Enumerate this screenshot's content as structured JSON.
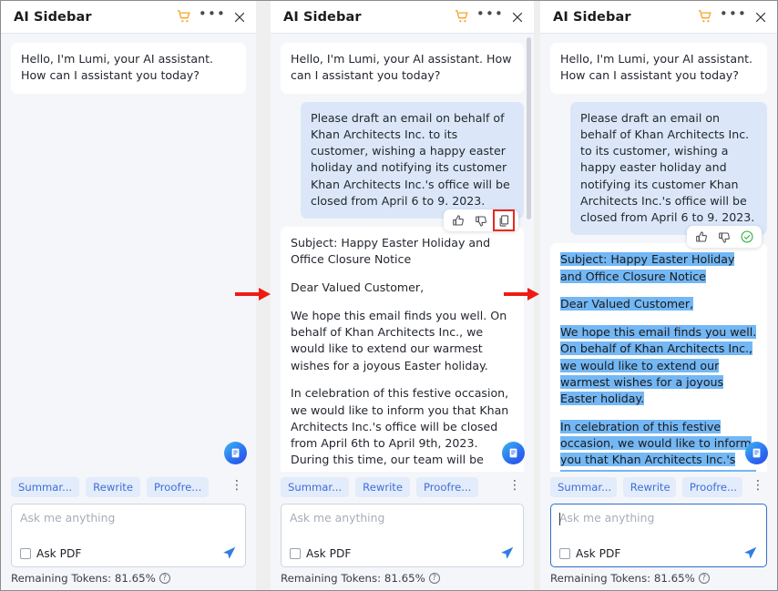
{
  "app": {
    "title": "AI Sidebar",
    "icons": {
      "cart": "shopping-cart-icon",
      "more": "more-options-icon",
      "close": "close-icon"
    }
  },
  "messages": {
    "greeting": "Hello, I'm Lumi, your AI assistant. How can I assistant you today?",
    "user_prompt": "Please draft an email on behalf of Khan Architects Inc. to its customer, wishing a happy easter holiday and notifying its customer Khan Architects Inc.'s office will be closed from April 6 to 9. 2023.",
    "answer_paragraphs": [
      "Subject: Happy Easter Holiday and Office Closure Notice",
      "Dear Valued Customer,",
      "We hope this email finds you well. On behalf of Khan Architects Inc., we would like to extend our warmest wishes for a joyous Easter holiday.",
      "In celebration of this festive occasion, we would like to inform you that Khan Architects Inc.'s office will be closed from April 6th to April 9th, 2023. During this time, our team will be taking a well-deserved break to spend quality time"
    ]
  },
  "feedback": {
    "thumbs_up": "thumbs-up-icon",
    "thumbs_down": "thumbs-down-icon",
    "copy": "copy-icon",
    "copied": "copied-check-icon"
  },
  "composer": {
    "chips": [
      "Summar...",
      "Rewrite",
      "Proofre..."
    ],
    "kebab": "more-actions-icon",
    "placeholder": "Ask me anything",
    "input_value": "",
    "ask_pdf_label": "Ask PDF",
    "send": "send-icon",
    "tokens_label": "Remaining Tokens: 81.65%",
    "help": "help-icon"
  },
  "panels": [
    {
      "id": "panel-1",
      "state": "initial",
      "selected": false,
      "input_focused": false,
      "copy_state": "idle",
      "highlight_copy": false,
      "scrollbar": false
    },
    {
      "id": "panel-2",
      "state": "copy-hover",
      "selected": false,
      "input_focused": false,
      "copy_state": "idle",
      "highlight_copy": true,
      "scrollbar": true
    },
    {
      "id": "panel-3",
      "state": "copied",
      "selected": true,
      "input_focused": true,
      "copy_state": "copied",
      "highlight_copy": false,
      "scrollbar": false
    }
  ],
  "annotations": {
    "arrow_color": "#ee1b15",
    "highlight_box_color": "#e8271f",
    "selection_color": "#73b7f5",
    "accent_blue": "#2f6fd0",
    "cart_orange": "#f5a327",
    "check_green": "#2fb344"
  }
}
